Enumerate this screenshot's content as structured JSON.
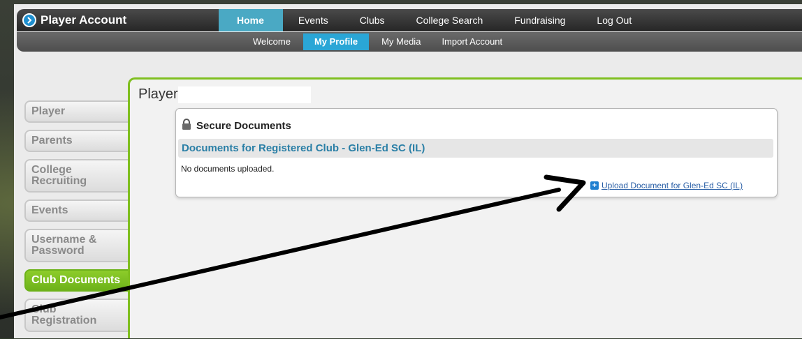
{
  "app": {
    "title": "Player Account"
  },
  "main_nav": [
    {
      "label": "Home",
      "active": true
    },
    {
      "label": "Events",
      "active": false
    },
    {
      "label": "Clubs",
      "active": false
    },
    {
      "label": "College Search",
      "active": false
    },
    {
      "label": "Fundraising",
      "active": false
    },
    {
      "label": "Log Out",
      "active": false
    }
  ],
  "sub_nav": [
    {
      "label": "Welcome",
      "active": false
    },
    {
      "label": "My Profile",
      "active": true
    },
    {
      "label": "My Media",
      "active": false
    },
    {
      "label": "Import Account",
      "active": false
    }
  ],
  "side_nav": [
    {
      "label": "Player",
      "active": false
    },
    {
      "label": "Parents",
      "active": false
    },
    {
      "label": "College Recruiting",
      "active": false
    },
    {
      "label": "Events",
      "active": false
    },
    {
      "label": "Username & Password",
      "active": false
    },
    {
      "label": "Club Documents",
      "active": true
    },
    {
      "label": "Club Registration",
      "active": false
    }
  ],
  "panel": {
    "title_prefix": "Player",
    "card": {
      "heading": "Secure Documents",
      "club_title": "Documents for Registered Club - Glen-Ed SC (IL)",
      "empty_text": "No documents uploaded.",
      "upload_label": "Upload Document for Glen-Ed SC (IL)"
    }
  },
  "colors": {
    "accent_green": "#7fbf1f",
    "active_tab_blue": "#4aa9c4",
    "link_blue": "#2a5fa6"
  },
  "icons": {
    "brand": "circle-arrow-right-icon",
    "lock": "lock-icon",
    "plus": "plus-icon"
  }
}
